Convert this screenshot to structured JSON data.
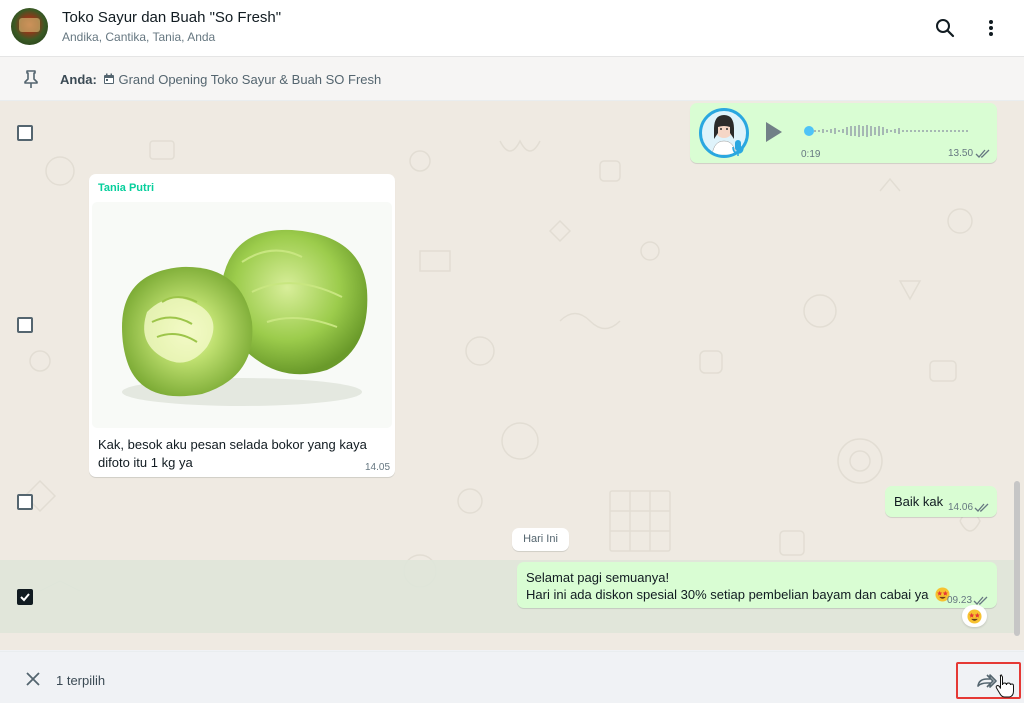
{
  "header": {
    "title": "Toko Sayur dan Buah \"So Fresh\"",
    "members": "Andika, Cantika, Tania, Anda"
  },
  "pinned": {
    "sender": "Anda:",
    "text": "Grand Opening Toko Sayur & Buah SO Fresh"
  },
  "messages": {
    "voice": {
      "duration": "0:19",
      "time": "13.50",
      "play_progress": 0
    },
    "image_msg": {
      "sender": "Tania Putri",
      "sender_color": "#06cf9c",
      "caption_line1": "Kak, besok aku pesan selada bokor yang kaya",
      "caption_line2": "difoto itu 1 kg ya",
      "time": "14.05"
    },
    "reply": {
      "text": "Baik kak",
      "time": "14.06"
    },
    "date_divider": "Hari Ini",
    "promo": {
      "line1": "Selamat pagi semuanya!",
      "line2": "Hari ini ada diskon spesial 30% setiap pembelian bayam dan cabai ya",
      "time": "09.23",
      "selected": true
    }
  },
  "footer": {
    "selected_count": "1 terpilih",
    "forward_highlight_color": "#e53935"
  },
  "colors": {
    "outgoing_bubble": "#d9fdd3",
    "incoming_bubble": "#ffffff",
    "chat_background": "#efeae2",
    "read_ticks": "#53bdeb"
  }
}
